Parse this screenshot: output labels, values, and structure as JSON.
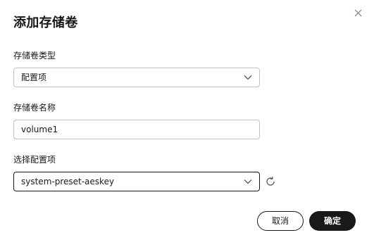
{
  "dialog": {
    "title": "添加存储卷",
    "close_icon": "close-icon"
  },
  "form": {
    "volume_type": {
      "label": "存储卷类型",
      "value": "配置项"
    },
    "volume_name": {
      "label": "存储卷名称",
      "value": "volume1"
    },
    "config_item": {
      "label": "选择配置项",
      "value": "system-preset-aeskey",
      "refresh_icon": "refresh-icon"
    }
  },
  "footer": {
    "cancel_label": "取消",
    "confirm_label": "确定"
  }
}
